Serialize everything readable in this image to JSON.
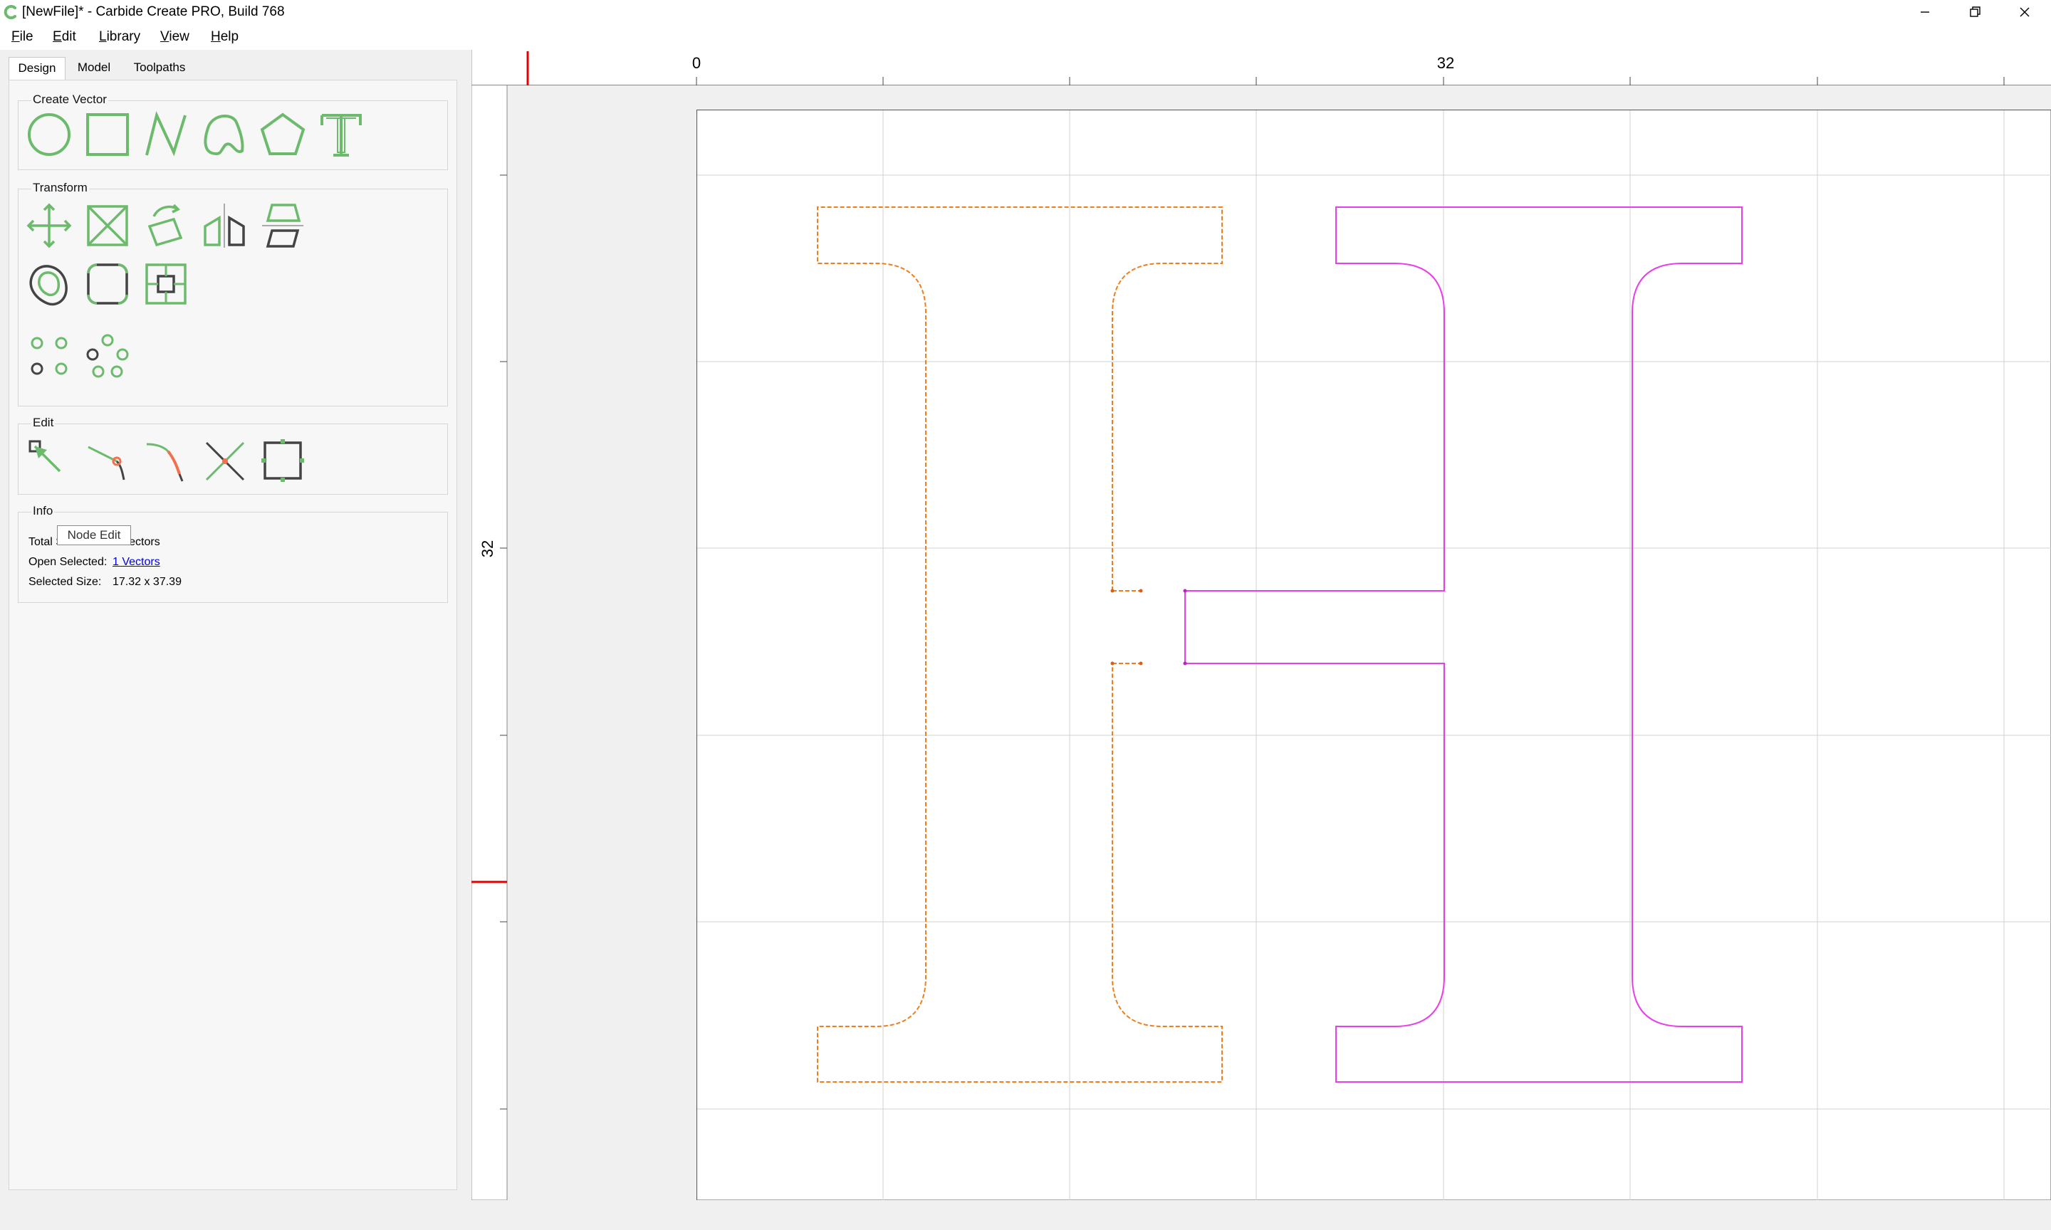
{
  "window": {
    "title": "[NewFile]* - Carbide Create PRO, Build 768"
  },
  "menu": {
    "file": "File",
    "edit": "Edit",
    "library": "Library",
    "view": "View",
    "help": "Help"
  },
  "tabs": {
    "design": "Design",
    "model": "Model",
    "toolpaths": "Toolpaths",
    "active": "design"
  },
  "groups": {
    "create_vector": "Create Vector",
    "transform": "Transform",
    "edit": "Edit",
    "info": "Info"
  },
  "tools": {
    "create_vector": [
      "circle-icon",
      "rectangle-icon",
      "polyline-icon",
      "curve-icon",
      "polygon-icon",
      "text-icon"
    ],
    "transform_row1": [
      "move-icon",
      "scale-icon",
      "rotate-icon",
      "mirror-icon",
      "align-icon"
    ],
    "transform_row2": [
      "offset-icon",
      "fillet-icon",
      "boolean-icon"
    ],
    "transform_row3": [
      "array-icon",
      "circular-array-icon"
    ],
    "edit": [
      "node-edit-icon",
      "trim-icon",
      "join-icon",
      "cut-icon",
      "bounding-box-icon"
    ]
  },
  "tooltip": "Node Edit",
  "info": {
    "total_selected_label": "Total Selected:",
    "total_selected_value": "1 Vectors",
    "open_selected_label": "Open Selected:",
    "open_selected_value": "1 Vectors",
    "selected_size_label": "Selected Size:",
    "selected_size_value": "17.32 x 37.39"
  },
  "ruler": {
    "h_labels": [
      "0",
      "32"
    ],
    "v_labels": [
      "32"
    ]
  },
  "colors": {
    "tool_green": "#6cba6c",
    "tool_dark": "#444444",
    "selected_vector": "#f07f1a",
    "unselected_vector": "#e83fe8",
    "cursor_marker": "#e00000",
    "grid": "#d0d0d0"
  }
}
